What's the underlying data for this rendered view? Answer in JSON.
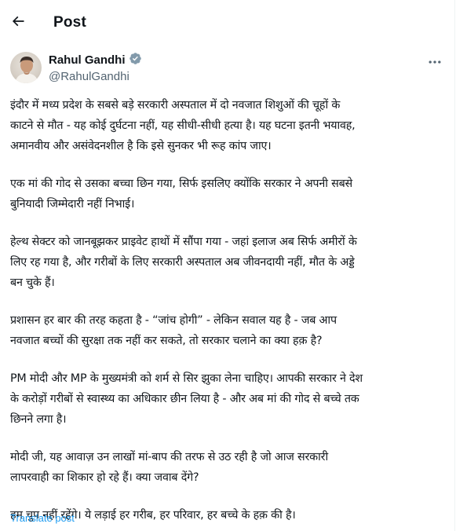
{
  "header": {
    "title": "Post",
    "back_icon": "arrow-left-icon"
  },
  "author": {
    "name": "Rahul Gandhi",
    "handle": "@RahulGandhi",
    "verified_icon": "verified-badge-icon",
    "verified_color": "#829aab"
  },
  "more_icon": "more-horizontal-icon",
  "post": {
    "paragraphs": [
      "इंदौर में मध्य प्रदेश के सबसे बड़े सरकारी अस्पताल में दो नवजात शिशुओं की चूहों के\nकाटने से मौत - यह कोई दुर्घटना नहीं, यह सीधी-सीधी हत्या है। यह घटना इतनी भयावह,\nअमानवीय और असंवेदनशील है कि इसे सुनकर भी रूह कांप जाए।",
      "एक मां की गोद से उसका बच्चा छिन गया, सिर्फ इसलिए क्योंकि सरकार ने अपनी सबसे\nबुनियादी जिम्मेदारी नहीं निभाई।",
      "हेल्थ सेक्टर को जानबूझकर प्राइवेट हाथों में सौंपा गया - जहां इलाज अब सिर्फ अमीरों के\nलिए रह गया है, और गरीबों के लिए सरकारी अस्पताल अब जीवनदायी नहीं, मौत के अड्डे\nबन चुके हैं।",
      "प्रशासन हर बार की तरह कहता है - “जांच होगी” - लेकिन सवाल यह है - जब आप\nनवजात बच्चों की सुरक्षा तक नहीं कर सकते, तो सरकार चलाने का क्या हक़ है?",
      "PM मोदी और MP के मुख्यमंत्री को शर्म से सिर झुका लेना चाहिए। आपकी सरकार ने देश\nके करोड़ों गरीबों से स्वास्थ्य का अधिकार छीन लिया है - और अब मां की गोद से बच्चे तक\nछिनने लगा है।",
      "मोदी जी, यह आवाज़ उन लाखों मां-बाप की तरफ से उठ रही है जो आज सरकारी\nलापरवाही का शिकार हो रहे हैं। क्या जवाब देंगे?",
      "हम चुप नहीं रहेंगे। ये लड़ाई हर गरीब, हर परिवार, हर बच्चे के हक़ की है।"
    ],
    "translate_label": "Translate post",
    "link_color": "#1d9bf0"
  }
}
